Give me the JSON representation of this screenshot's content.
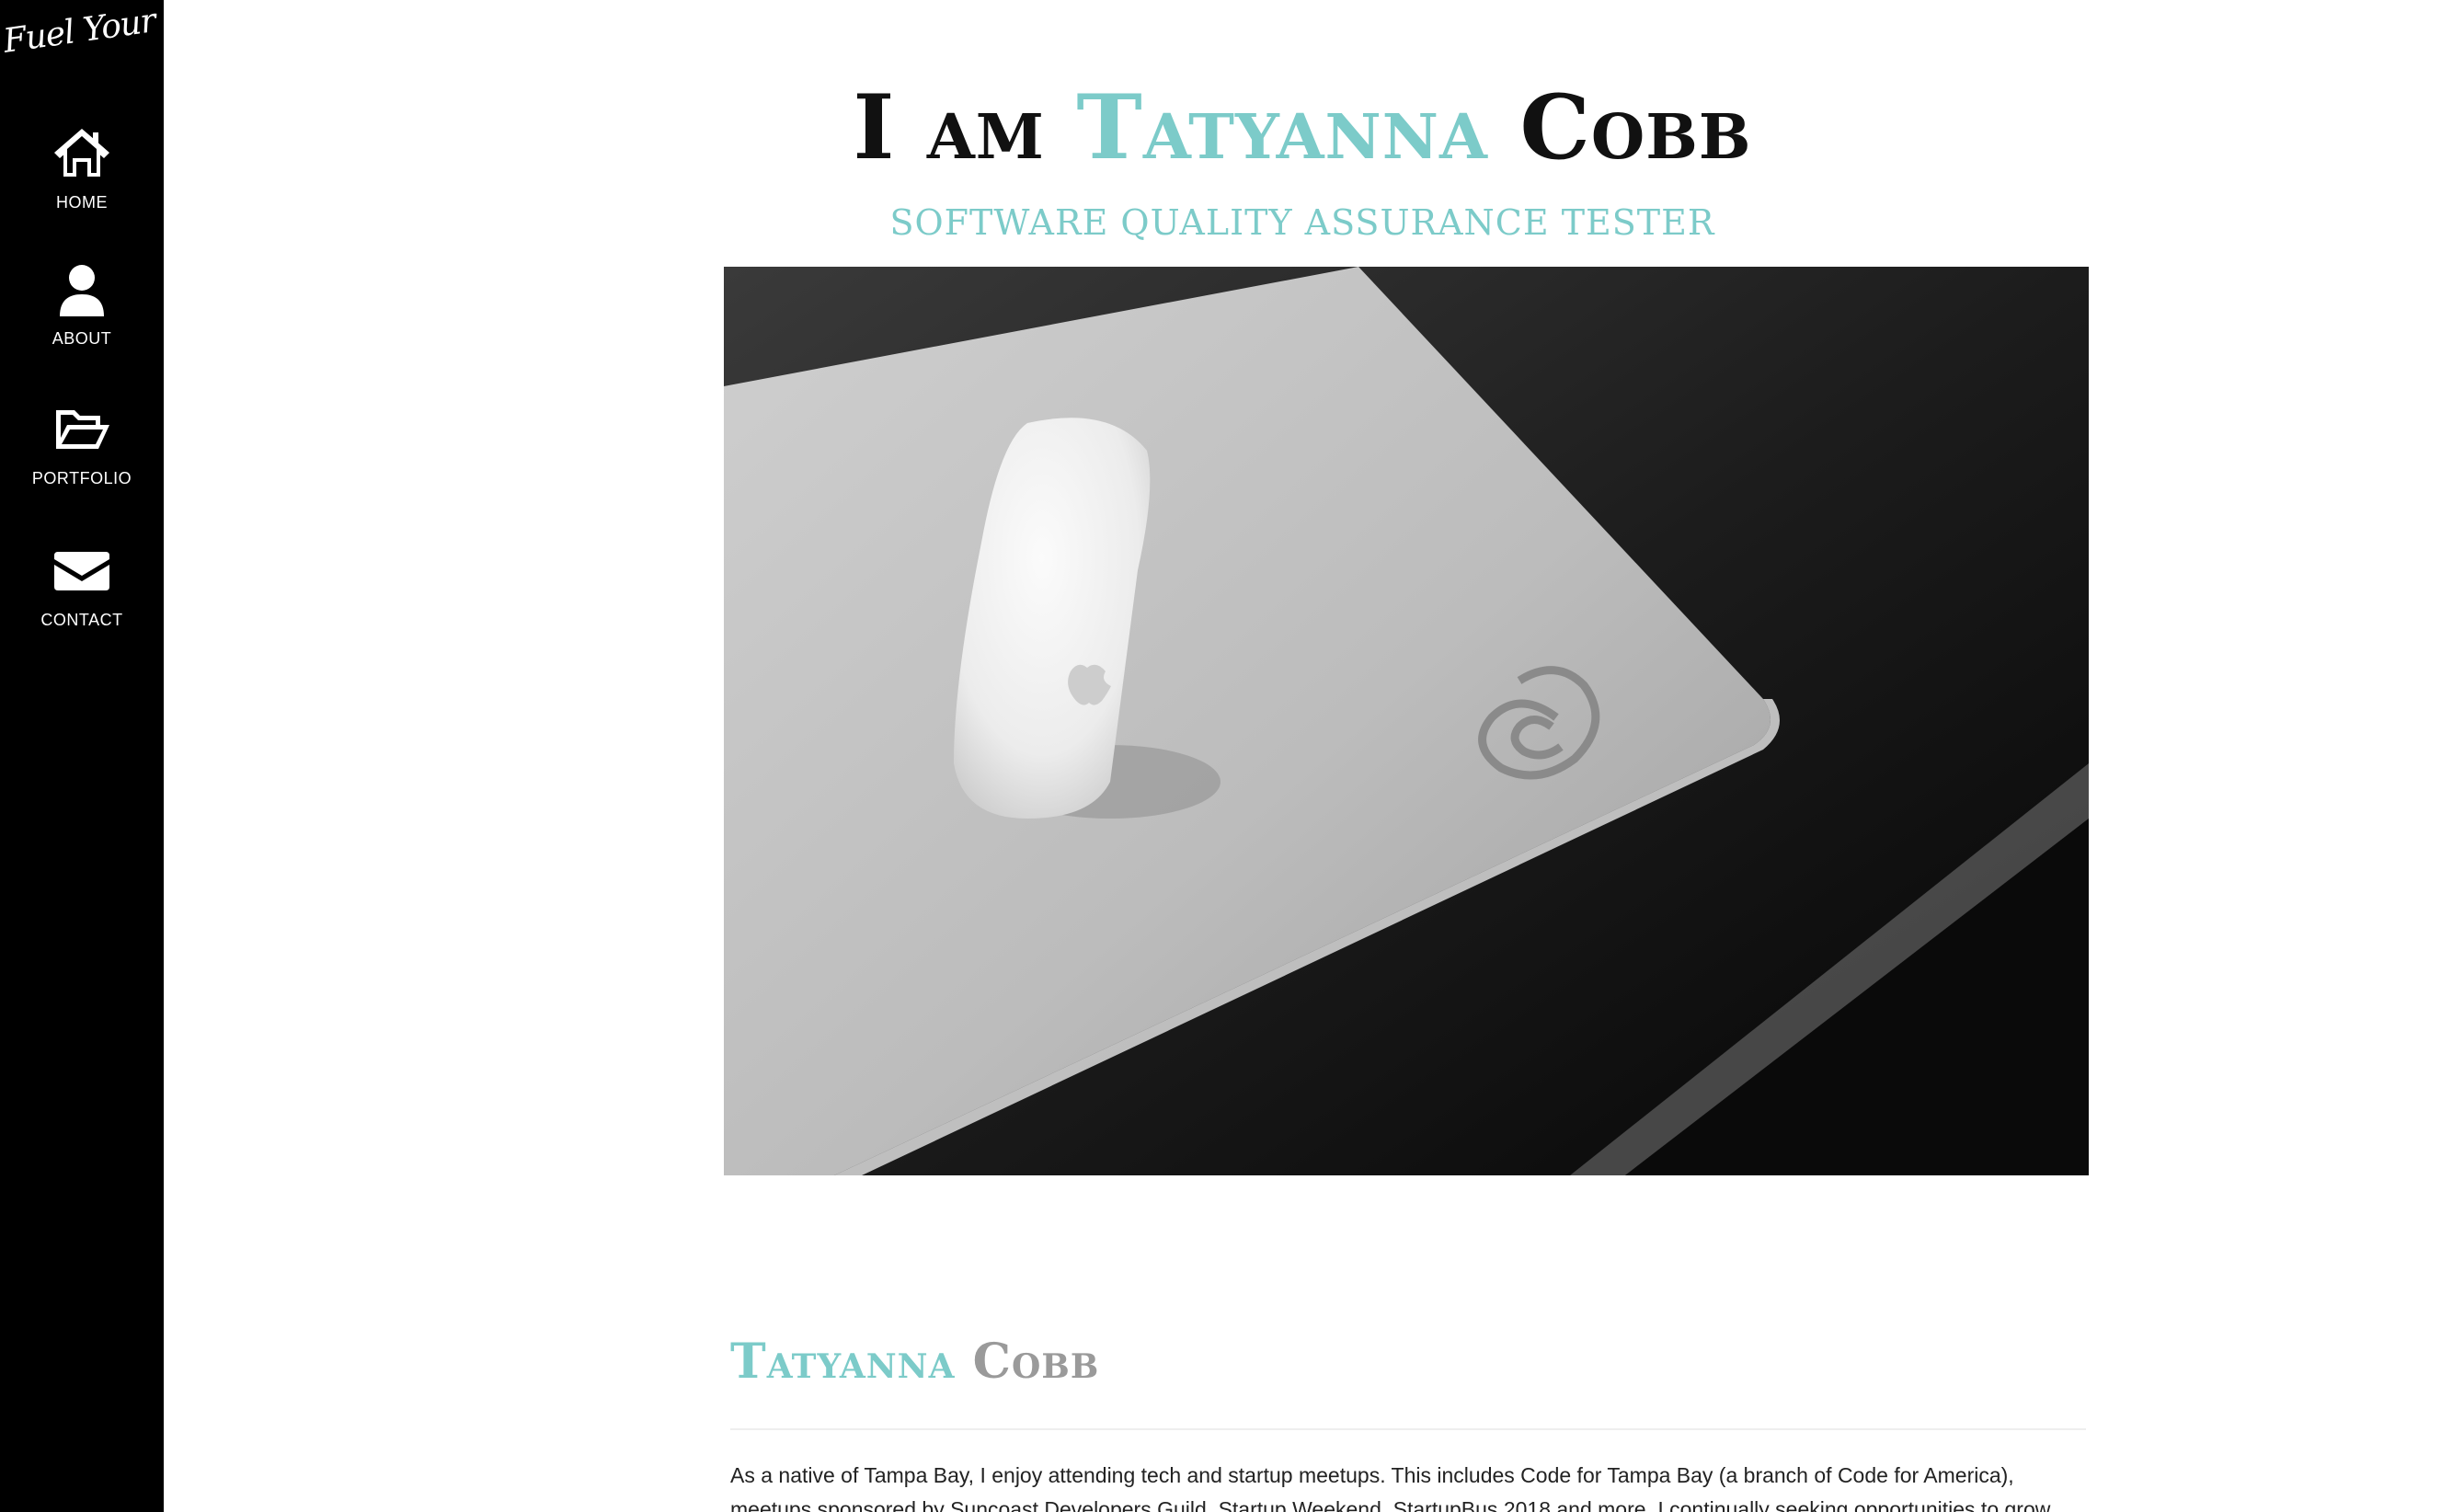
{
  "sidebar": {
    "logo_text": "Fuel Your Passion",
    "items": [
      {
        "label": "HOME",
        "icon": "home-icon"
      },
      {
        "label": "ABOUT",
        "icon": "user-icon"
      },
      {
        "label": "PORTFOLIO",
        "icon": "folder-open-icon"
      },
      {
        "label": "CONTACT",
        "icon": "envelope-icon"
      }
    ]
  },
  "hero": {
    "title_prefix": "I am",
    "title_first": "Tatyanna",
    "title_last": "Cobb",
    "subtitle": "SOFTWARE QUALITY ASSURANCE TESTER"
  },
  "about": {
    "heading_first": "Tatyanna",
    "heading_last": "Cobb",
    "bio": "As a native of Tampa Bay, I enjoy attending tech and startup meetups. This includes Code for Tampa Bay (a branch of Code for America), meetups sponsored by Suncoast Developers Guild, Startup Weekend, StartupBus 2018 and more. I continually seeking opportunities to grow and learn."
  },
  "colors": {
    "accent": "#7ccbc9",
    "sidebar_bg": "#000000",
    "heading_gray": "#9a9a9a"
  }
}
